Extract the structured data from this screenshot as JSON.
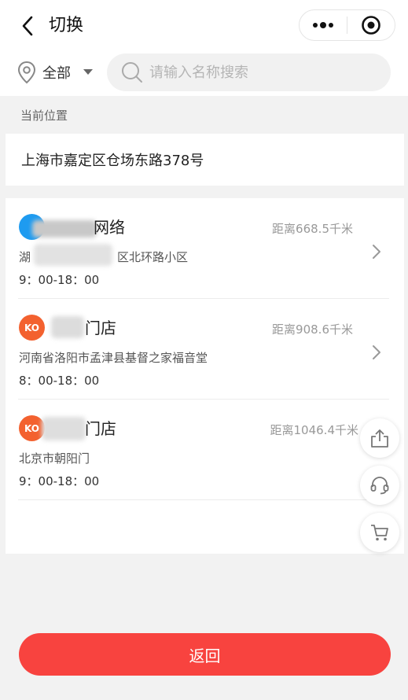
{
  "header": {
    "title": "切换",
    "back_icon": "back-arrow-icon",
    "more_icon": "more-dots-icon",
    "close_icon": "target-circle-icon"
  },
  "filter": {
    "region_label": "全部",
    "location_icon": "location-pin-icon",
    "caret_icon": "caret-down-icon",
    "search_placeholder": "请输入名称搜索",
    "search_icon": "search-icon"
  },
  "current_location": {
    "section_label": "当前位置",
    "address": "上海市嘉定区仓场东路378号"
  },
  "stores": [
    {
      "name_suffix": "网络",
      "distance": "距离668.5千米",
      "address_prefix": "湖",
      "address_suffix": "区北环路小区",
      "hours": "9：00-18：00",
      "logo_color": "#1e9bf0",
      "has_chevron": true
    },
    {
      "name_suffix": "门店",
      "distance": "距离908.6千米",
      "address": "河南省洛阳市孟津县基督之家福音堂",
      "hours": "8：00-18：00",
      "logo_color": "#f3612f",
      "logo_text": "KO",
      "has_chevron": true
    },
    {
      "name_suffix": "门店",
      "distance": "距离1046.4千米",
      "address": "北京市朝阳门",
      "hours": "9：00-18：00",
      "logo_color": "#f3612f",
      "logo_text": "KO",
      "has_chevron": false
    }
  ],
  "floating_actions": [
    "share-icon",
    "headset-icon",
    "cart-icon"
  ],
  "footer": {
    "return_label": "返回",
    "return_color": "#f8433f"
  }
}
